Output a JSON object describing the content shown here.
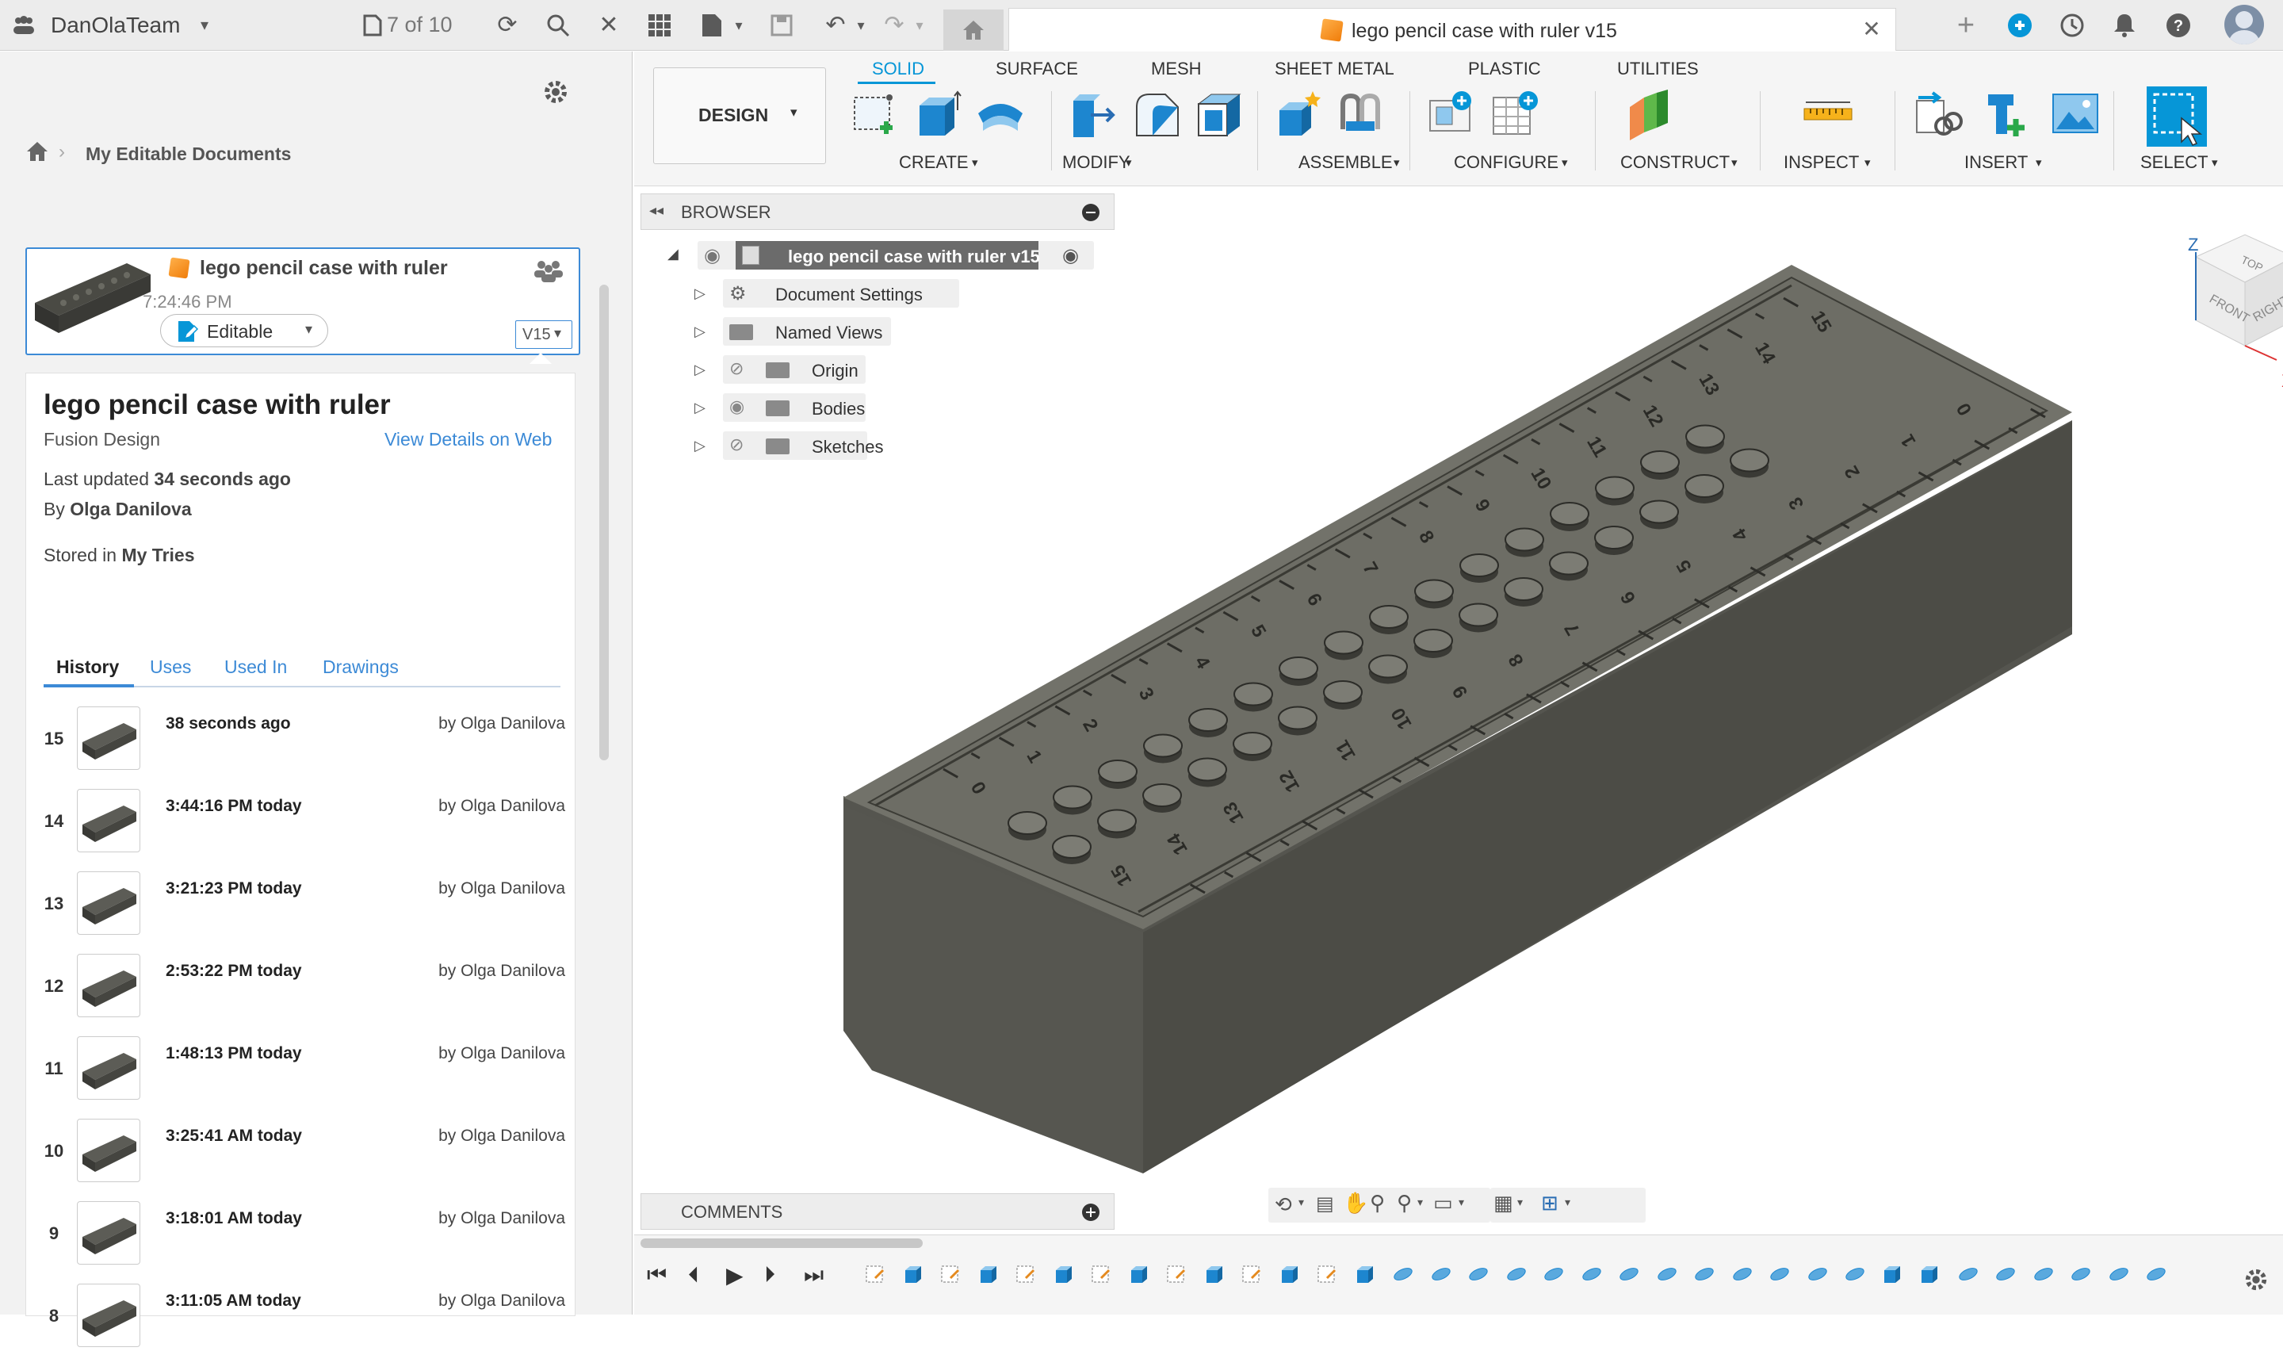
{
  "topbar": {
    "team_name": "DanOlaTeam",
    "version_count": "7 of 10",
    "doc_tab_title": "lego pencil case with ruler v15"
  },
  "left_panel": {
    "breadcrumb": "My Editable Documents",
    "card": {
      "title": "lego pencil case with ruler",
      "time": "7:24:46 PM",
      "status": "Editable",
      "version": "V15"
    },
    "details": {
      "title": "lego pencil case with ruler",
      "type": "Fusion Design",
      "view_link": "View Details on Web",
      "last_updated_label": "Last updated",
      "last_updated_value": "34 seconds ago",
      "by_label": "By",
      "by_value": "Olga Danilova",
      "stored_label": "Stored in",
      "stored_value": "My Tries"
    },
    "tabs": [
      "History",
      "Uses",
      "Used In",
      "Drawings"
    ],
    "history": [
      {
        "num": "15",
        "time": "38 seconds ago",
        "by": "by Olga Danilova"
      },
      {
        "num": "14",
        "time": "3:44:16 PM today",
        "by": "by Olga Danilova"
      },
      {
        "num": "13",
        "time": "3:21:23 PM today",
        "by": "by Olga Danilova"
      },
      {
        "num": "12",
        "time": "2:53:22 PM today",
        "by": "by Olga Danilova"
      },
      {
        "num": "11",
        "time": "1:48:13 PM today",
        "by": "by Olga Danilova"
      },
      {
        "num": "10",
        "time": "3:25:41 AM today",
        "by": "by Olga Danilova"
      },
      {
        "num": "9",
        "time": "3:18:01 AM today",
        "by": "by Olga Danilova"
      },
      {
        "num": "8",
        "time": "3:11:05 AM today",
        "by": "by Olga Danilova"
      }
    ]
  },
  "toolbar": {
    "workspace": "DESIGN",
    "tabs": [
      "SOLID",
      "SURFACE",
      "MESH",
      "SHEET METAL",
      "PLASTIC",
      "UTILITIES"
    ],
    "groups": [
      "CREATE",
      "MODIFY",
      "ASSEMBLE",
      "CONFIGURE",
      "CONSTRUCT",
      "INSPECT",
      "INSERT",
      "SELECT"
    ]
  },
  "browser": {
    "header": "BROWSER",
    "root": "lego pencil case with ruler v15",
    "items": [
      "Document Settings",
      "Named Views",
      "Origin",
      "Bodies",
      "Sketches"
    ]
  },
  "comments": {
    "header": "COMMENTS"
  },
  "viewcube": {
    "top": "TOP",
    "front": "FRONT",
    "right": "RIGHT",
    "z": "Z",
    "x": "X"
  },
  "model": {
    "ruler_top": [
      "0",
      "1",
      "2",
      "3",
      "4",
      "5",
      "6",
      "7",
      "8",
      "9",
      "10",
      "11",
      "12",
      "13",
      "14",
      "15"
    ],
    "ruler_side": [
      "15",
      "14",
      "13",
      "12",
      "11",
      "10",
      "9",
      "8",
      "7",
      "6",
      "5",
      "4",
      "3",
      "2",
      "1",
      "0"
    ]
  },
  "colors": {
    "accent": "#0696d7",
    "link": "#3c8ad6",
    "model": "#5a5a52"
  }
}
